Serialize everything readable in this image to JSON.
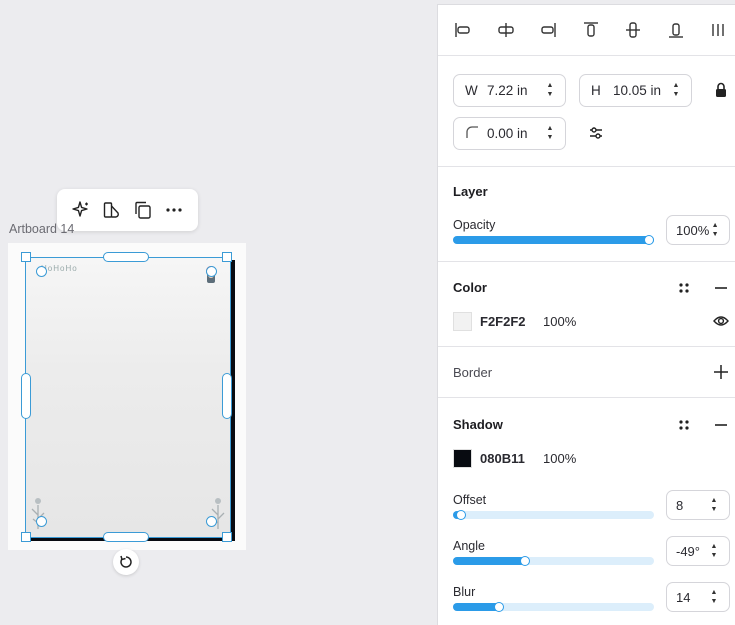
{
  "canvas": {
    "artboard_label": "Artboard 14",
    "artboard_top_text": "HoHoHo"
  },
  "floating_toolbar": {
    "items": [
      "sparkle-icon",
      "shapes-icon",
      "duplicate-icon",
      "more-icon"
    ]
  },
  "align_toolbar": {
    "items": [
      "align-left-icon",
      "align-center-horizontal-icon",
      "align-right-icon",
      "align-top-icon",
      "align-middle-vertical-icon",
      "align-bottom-icon",
      "distribute-icon"
    ]
  },
  "dimensions": {
    "width_prefix": "W",
    "width_value": "7.22 in",
    "height_prefix": "H",
    "height_value": "10.05 in",
    "radius_value": "0.00 in"
  },
  "layer": {
    "title": "Layer",
    "opacity_label": "Opacity",
    "opacity_value": "100%",
    "opacity_fraction": 1.0
  },
  "color": {
    "title": "Color",
    "hex": "F2F2F2",
    "percent": "100%",
    "swatch": "#F2F2F2"
  },
  "border": {
    "title": "Border"
  },
  "shadow": {
    "title": "Shadow",
    "hex": "080B11",
    "percent": "100%",
    "swatch": "#080B11",
    "offset_label": "Offset",
    "offset_value": "8",
    "offset_fraction": 0.04,
    "angle_label": "Angle",
    "angle_value": "-49°",
    "angle_fraction": 0.36,
    "blur_label": "Blur",
    "blur_value": "14",
    "blur_fraction": 0.23
  },
  "colors": {
    "accent": "#2b9be8",
    "selection": "#3b9bd6"
  }
}
